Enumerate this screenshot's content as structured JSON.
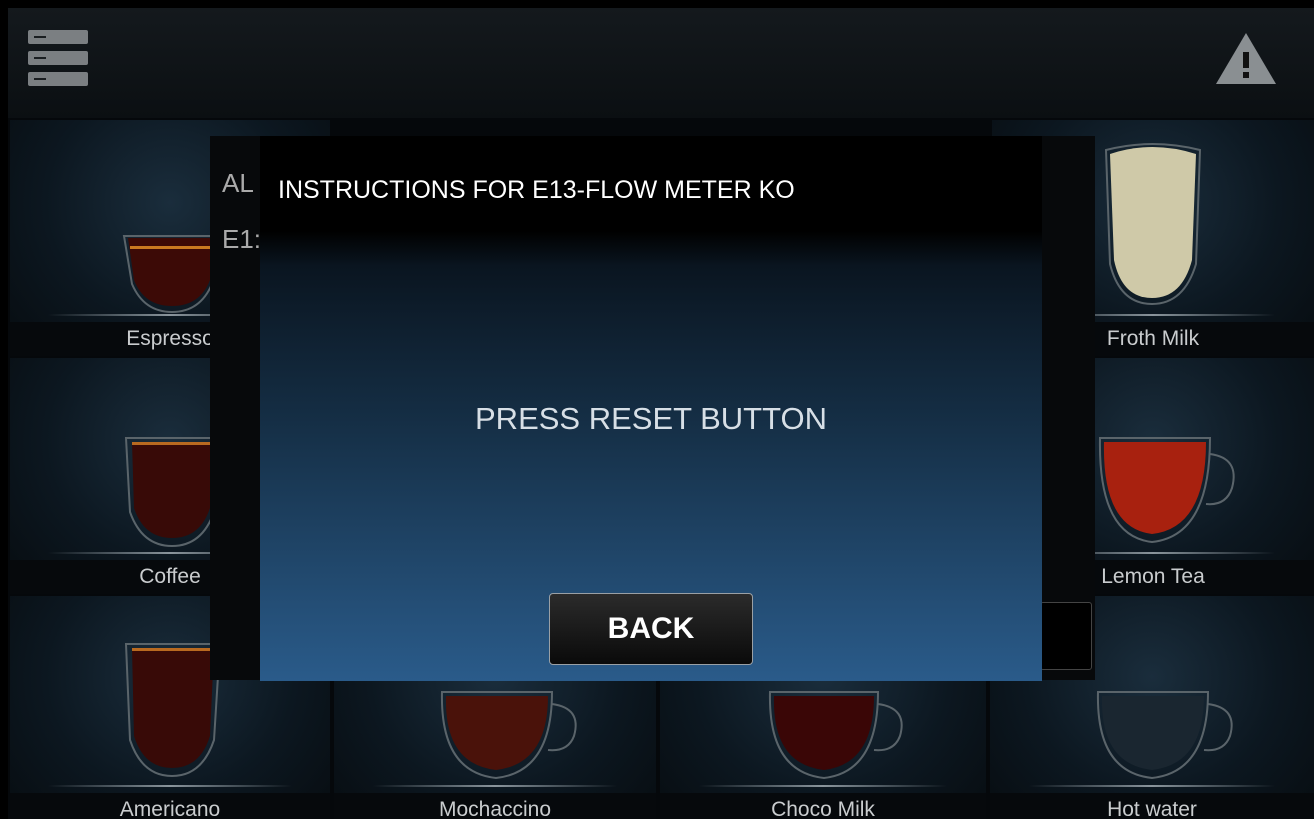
{
  "header": {
    "menu_icon": "menu-list-icon",
    "alert_icon": "warning-icon"
  },
  "beverages": [
    {
      "label": "Espresso"
    },
    {
      "label": "Froth Milk"
    },
    {
      "label": "Coffee"
    },
    {
      "label": "Lemon Tea"
    },
    {
      "label": "Americano"
    },
    {
      "label": "Mochaccino"
    },
    {
      "label": "Choco Milk"
    },
    {
      "label": "Hot water"
    }
  ],
  "background_dialog": {
    "line1": "AL",
    "line2": "E1:"
  },
  "modal": {
    "title": "INSTRUCTIONS FOR E13-FLOW METER KO",
    "message": "PRESS RESET BUTTON",
    "back_label": "BACK"
  },
  "colors": {
    "accent_blue": "#2a5b8a",
    "coffee": "#3a0a06",
    "tea": "#a8210f"
  }
}
